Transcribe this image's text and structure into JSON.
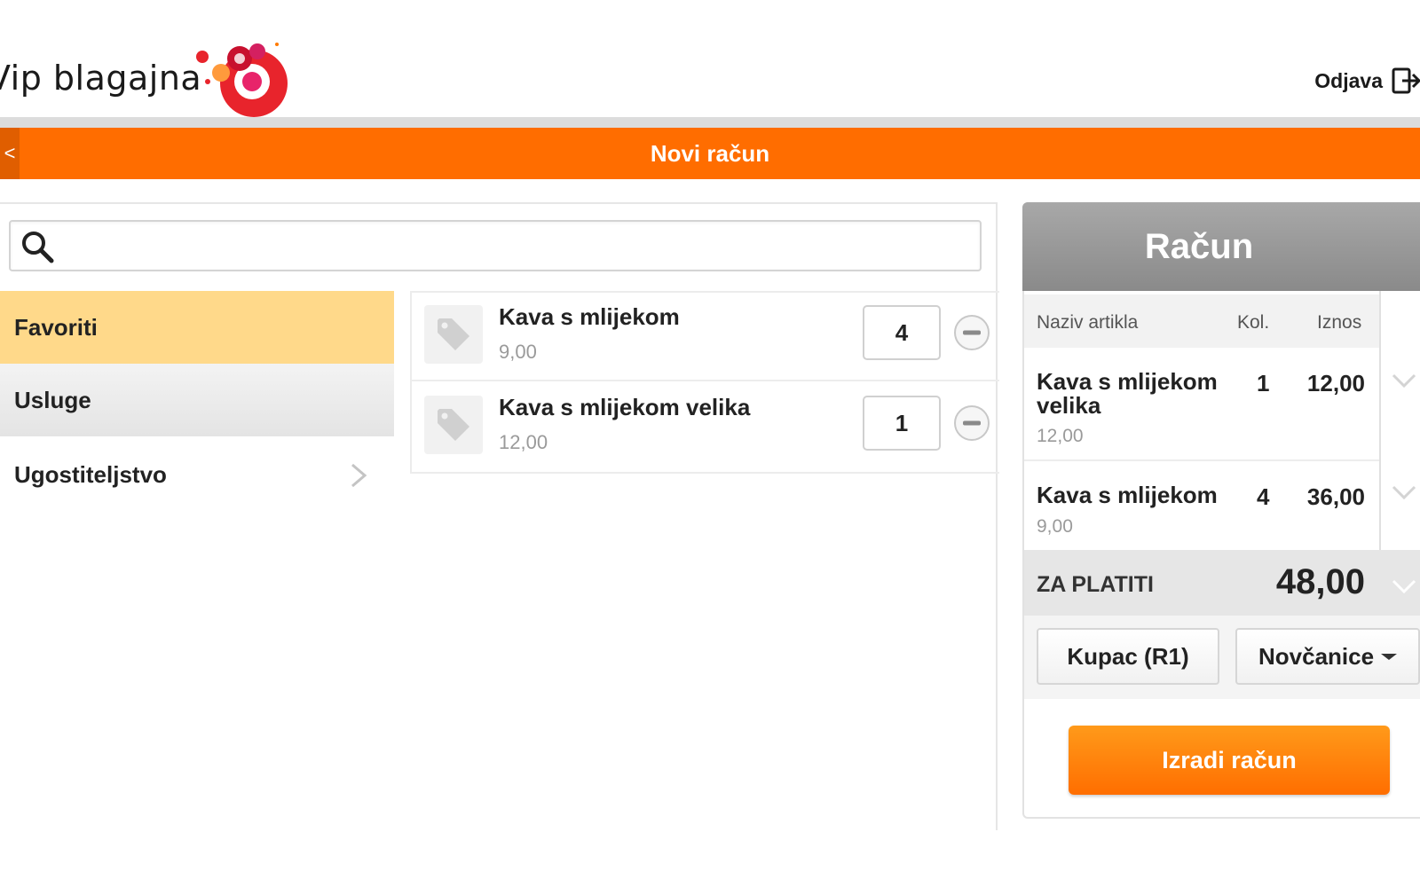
{
  "header": {
    "app_title": "Vip blagajna",
    "logout_label": "Odjava"
  },
  "topbar": {
    "back_label": "<",
    "title": "Novi račun"
  },
  "search": {
    "placeholder": "",
    "value": ""
  },
  "categories": [
    {
      "label": "Favoriti",
      "selected": true
    },
    {
      "label": "Usluge",
      "selected": false
    },
    {
      "label": "Ugostiteljstvo",
      "selected": false,
      "has_children": true
    }
  ],
  "products": [
    {
      "name": "Kava s mlijekom",
      "price": "9,00",
      "qty": "4"
    },
    {
      "name": "Kava s mlijekom velika",
      "price": "12,00",
      "qty": "1"
    }
  ],
  "receipt": {
    "title": "Račun",
    "columns": {
      "name": "Naziv artikla",
      "qty": "Kol.",
      "amount": "Iznos"
    },
    "lines": [
      {
        "name_line1": "Kava s mlijekom",
        "name_line2": "velika",
        "qty": "1",
        "amount": "12,00",
        "unit_price": "12,00"
      },
      {
        "name_line1": "Kava s mlijekom",
        "name_line2": "",
        "qty": "4",
        "amount": "36,00",
        "unit_price": "9,00"
      }
    ],
    "total_label": "ZA PLATITI",
    "total_value": "48,00",
    "customer_button": "Kupac (R1)",
    "payment_method": "Novčanice",
    "create_button": "Izradi račun"
  },
  "colors": {
    "accent_orange": "#ff6d00",
    "selected_category": "#ffd98a",
    "receipt_header": "#999999"
  }
}
